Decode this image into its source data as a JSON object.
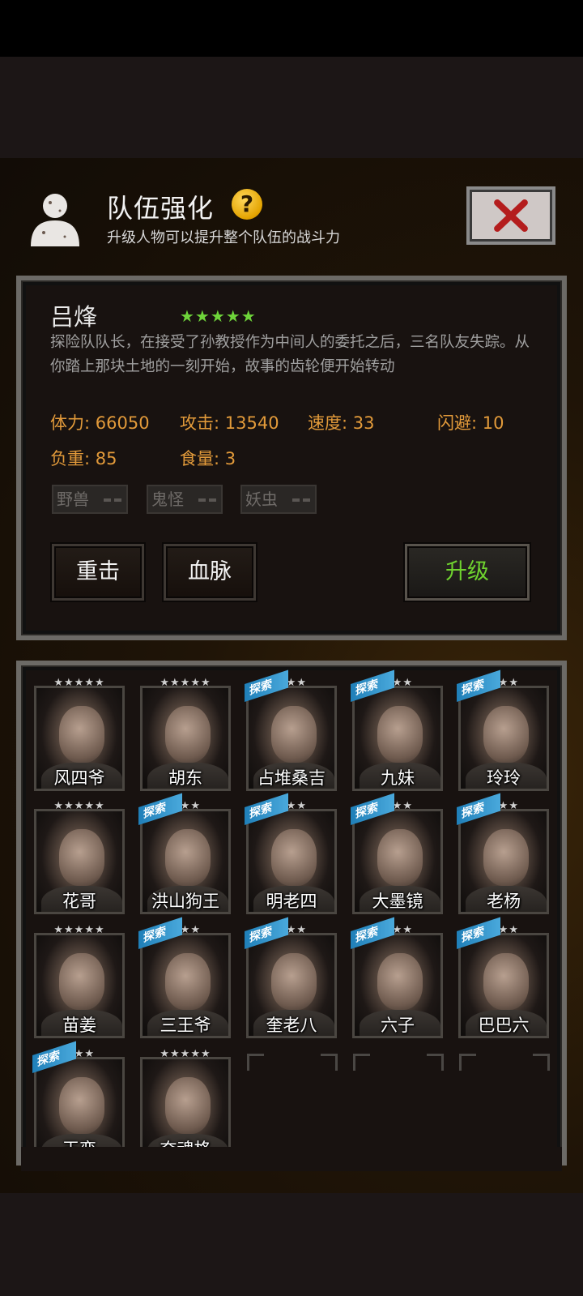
{
  "header": {
    "title": "队伍强化",
    "help_icon": "?",
    "subtitle": "升级人物可以提升整个队伍的战斗力"
  },
  "character": {
    "name": "吕烽",
    "stars": "★★★★★",
    "description": "探险队队长，在接受了孙教授作为中间人的委托之后，三名队友失踪。从你踏上那块土地的一刻开始，故事的齿轮便开始转动",
    "stats": {
      "hp": "体力: 66050",
      "attack": "攻击: 13540",
      "speed": "速度: 33",
      "dodge": "闪避: 10",
      "load": "负重: 85",
      "food": "食量: 3"
    },
    "traits": [
      "野兽",
      "鬼怪",
      "妖虫"
    ]
  },
  "buttons": {
    "heavy_strike": "重击",
    "bloodline": "血脉",
    "upgrade": "升级"
  },
  "roster": {
    "tag_label": "探索",
    "members": [
      {
        "name": "风四爷",
        "stars": "★★★★★",
        "tagged": false
      },
      {
        "name": "胡东",
        "stars": "★★★★★",
        "tagged": false
      },
      {
        "name": "占堆桑吉",
        "stars": "★★★",
        "tagged": true
      },
      {
        "name": "九妹",
        "stars": "★★★",
        "tagged": true
      },
      {
        "name": "玲玲",
        "stars": "★★★",
        "tagged": true
      },
      {
        "name": "花哥",
        "stars": "★★★★★",
        "tagged": false
      },
      {
        "name": "洪山狗王",
        "stars": "★★★",
        "tagged": true
      },
      {
        "name": "明老四",
        "stars": "★★★",
        "tagged": true
      },
      {
        "name": "大墨镜",
        "stars": "★★★",
        "tagged": true
      },
      {
        "name": "老杨",
        "stars": "★★★",
        "tagged": true
      },
      {
        "name": "苗姜",
        "stars": "★★★★★",
        "tagged": false
      },
      {
        "name": "三王爷",
        "stars": "★★★",
        "tagged": true
      },
      {
        "name": "奎老八",
        "stars": "★★★",
        "tagged": true
      },
      {
        "name": "六子",
        "stars": "★★★",
        "tagged": true
      },
      {
        "name": "巴巴六",
        "stars": "★★★",
        "tagged": true
      },
      {
        "name": "王峦",
        "stars": "★★★",
        "tagged": true
      },
      {
        "name": "夺魂格",
        "stars": "★★★★★",
        "tagged": false
      }
    ]
  },
  "colors": {
    "stat_text": "#e29a3a",
    "star_green": "#6ed43a",
    "upgrade_text": "#6fd32f",
    "tag_blue": "#2f8fc8"
  }
}
